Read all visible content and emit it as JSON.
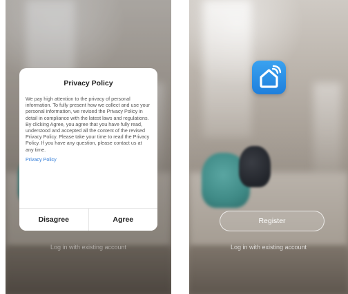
{
  "left_screen": {
    "dialog": {
      "title": "Privacy Policy",
      "body": "We pay high attention to the privacy of personal information. To fully present how we collect and use your personal information, we revised the Privacy Policy in detail in compliance with the latest laws and regulations. By clicking Agree, you agree that you have fully read, understood and accepted all the content of the revised Privacy Policy. Please take your time to read the Privacy Policy. If you have any question, please contact us at any time.",
      "link_label": "Privacy Policy",
      "disagree_label": "Disagree",
      "agree_label": "Agree"
    },
    "login_link": "Log in with existing account"
  },
  "right_screen": {
    "app_icon": "smart-home-icon",
    "register_label": "Register",
    "login_link": "Log in with existing account"
  },
  "colors": {
    "link": "#2f7bd8",
    "app_icon_blue": "#1f7fdc"
  }
}
